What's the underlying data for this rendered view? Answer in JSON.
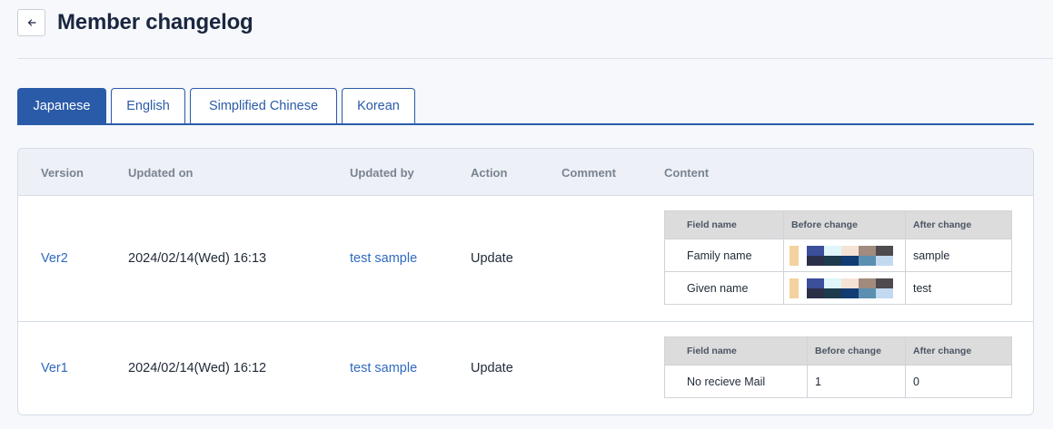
{
  "header": {
    "title": "Member changelog"
  },
  "tabs": [
    "Japanese",
    "English",
    "Simplified Chinese",
    "Korean"
  ],
  "table": {
    "columns": [
      "Version",
      "Updated on",
      "Updated by",
      "Action",
      "Comment",
      "Content"
    ],
    "rows": [
      {
        "version": "Ver2",
        "updated_on": "2024/02/14(Wed) 16:13",
        "updated_by": "test sample",
        "action": "Update",
        "comment": "",
        "content": {
          "headers": [
            "Field name",
            "Before change",
            "After change"
          ],
          "rows": [
            {
              "field": "Family name",
              "before": "",
              "after": "sample"
            },
            {
              "field": "Given name",
              "before": "",
              "after": "test"
            }
          ]
        }
      },
      {
        "version": "Ver1",
        "updated_on": "2024/02/14(Wed) 16:12",
        "updated_by": "test sample",
        "action": "Update",
        "comment": "",
        "content": {
          "headers": [
            "Field name",
            "Before change",
            "After change"
          ],
          "rows": [
            {
              "field": "No recieve Mail",
              "before": "1",
              "after": "0"
            }
          ]
        }
      }
    ]
  },
  "colors": {
    "accent": "#2a5ba8",
    "link": "#2f6ac0",
    "title": "#1b2740",
    "mosaic_palette": [
      "#f3d29e",
      "#3b4f9b",
      "#dff6fb",
      "#f5e4d6",
      "#a08b7c",
      "#4f4a4d",
      "#2c2f48",
      "#1e3a4d",
      "#123c73",
      "#5a8fb0",
      "#c2d9f0"
    ]
  },
  "icons": {
    "back": "arrow-left-icon"
  }
}
